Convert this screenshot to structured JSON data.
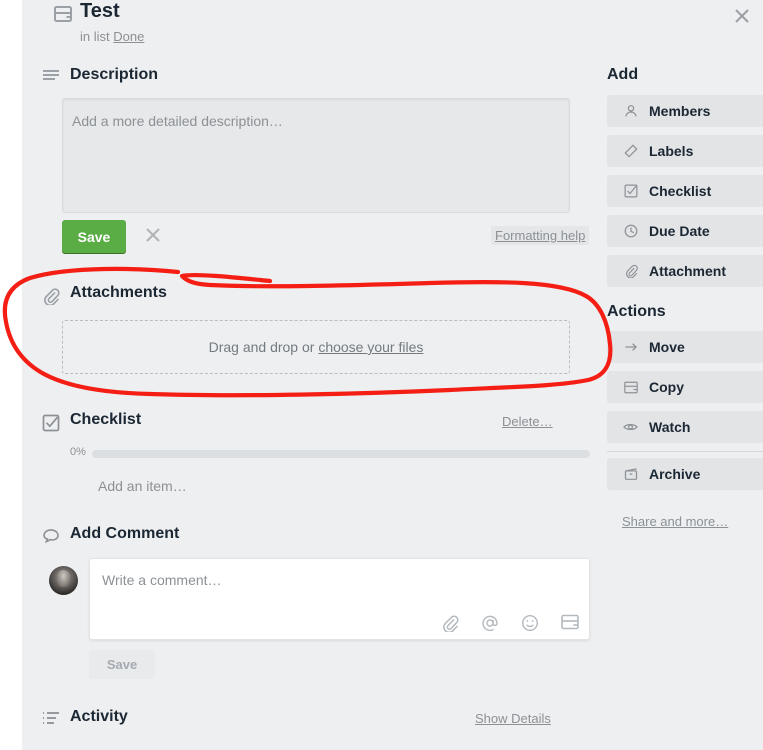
{
  "card": {
    "icon": "card-icon",
    "title": "Test",
    "in_list_prefix": "in list",
    "list_name": "Done",
    "close_icon": "close-icon"
  },
  "description": {
    "icon": "description-lines-icon",
    "heading": "Description",
    "placeholder": "Add a more detailed description…",
    "value": "",
    "save_label": "Save",
    "cancel_icon": "close-icon",
    "formatting_help_label": "Formatting help"
  },
  "attachments": {
    "icon": "paperclip-icon",
    "heading": "Attachments",
    "dropzone_prefix": "Drag and drop or ",
    "dropzone_link": "choose your files"
  },
  "checklist": {
    "icon": "checkbox-checked-icon",
    "heading": "Checklist",
    "delete_label": "Delete…",
    "percent_label": "0%",
    "percent_value": 0,
    "add_item_label": "Add an item…"
  },
  "comment": {
    "icon": "speech-bubble-icon",
    "heading": "Add Comment",
    "avatar": "user-avatar",
    "placeholder": "Write a comment…",
    "value": "",
    "tools": [
      "paperclip-icon",
      "mention-at-icon",
      "emoji-smiley-icon",
      "card-icon"
    ],
    "save_label": "Save"
  },
  "activity": {
    "icon": "activity-list-icon",
    "heading": "Activity",
    "show_details_label": "Show Details"
  },
  "sidebar": {
    "add_heading": "Add",
    "add_items": [
      {
        "label": "Members",
        "icon": "person-icon"
      },
      {
        "label": "Labels",
        "icon": "label-tag-icon"
      },
      {
        "label": "Checklist",
        "icon": "checkbox-checked-icon"
      },
      {
        "label": "Due Date",
        "icon": "clock-icon"
      },
      {
        "label": "Attachment",
        "icon": "paperclip-icon"
      }
    ],
    "actions_heading": "Actions",
    "action_items": [
      {
        "label": "Move",
        "icon": "arrow-right-icon"
      },
      {
        "label": "Copy",
        "icon": "card-icon"
      },
      {
        "label": "Watch",
        "icon": "eye-icon"
      },
      {
        "label": "Archive",
        "icon": "archive-box-icon"
      }
    ],
    "share_label": "Share and more…"
  },
  "annotation": {
    "color": "#f51e14",
    "shape": "hand-drawn-ellipse-around-attachments"
  },
  "colors": {
    "panel_bg": "#edeff0",
    "save_green": "#5aac44",
    "text_dark": "#1b2733",
    "text_muted": "#8c9196",
    "button_gray": "#e2e4e6",
    "annotation_red": "#f51e14"
  }
}
